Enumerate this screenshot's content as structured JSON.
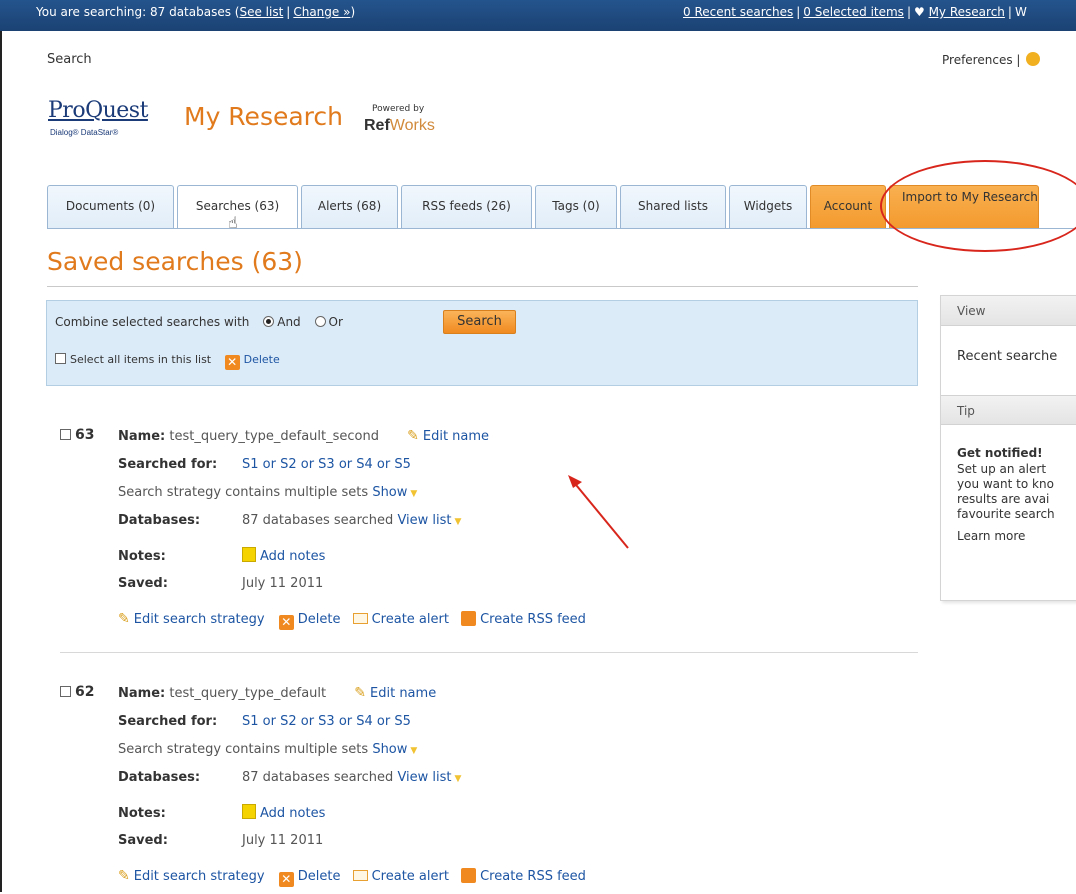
{
  "topbar": {
    "searching_prefix": "You are searching: 87 databases (",
    "see_list": "See list",
    "change": "Change »",
    "searching_suffix": ")",
    "recent_searches": "0 Recent searches",
    "selected_items": "0 Selected items",
    "my_research": "My Research",
    "trailing": "W"
  },
  "header": {
    "search_link": "Search",
    "preferences": "Preferences",
    "logo_text": "ProQuest",
    "logo_sub": "Dialog® DataStar®",
    "app_title": "My Research",
    "powered_by": "Powered by",
    "refworks_ref": "Ref",
    "refworks_works": "Works"
  },
  "tabs": [
    {
      "label": "Documents (0)"
    },
    {
      "label": "Searches (63)"
    },
    {
      "label": "Alerts (68)"
    },
    {
      "label": "RSS feeds (26)"
    },
    {
      "label": "Tags (0)"
    },
    {
      "label": "Shared lists"
    },
    {
      "label": "Widgets"
    },
    {
      "label": "Account"
    },
    {
      "label": "Import to My Research"
    }
  ],
  "page_title": "Saved searches (63)",
  "combine": {
    "label": "Combine selected searches with",
    "and": "And",
    "or": "Or",
    "selected": "And",
    "search_button": "Search",
    "select_all": "Select all items in this list",
    "delete": "Delete"
  },
  "records": [
    {
      "number": "63",
      "name_label": "Name:",
      "name": "test_query_type_default_second",
      "edit_name": "Edit name",
      "searched_for_label": "Searched for:",
      "searched_for": "S1 or S2 or S3 or S4 or S5",
      "strategy_text": "Search strategy contains multiple sets",
      "show": "Show",
      "databases_label": "Databases:",
      "databases": "87 databases searched",
      "view_list": "View list",
      "notes_label": "Notes:",
      "add_notes": "Add notes",
      "saved_label": "Saved:",
      "saved": "July 11 2011",
      "edit_strategy": "Edit search strategy",
      "delete": "Delete",
      "create_alert": "Create alert",
      "create_rss": "Create RSS feed"
    },
    {
      "number": "62",
      "name_label": "Name:",
      "name": "test_query_type_default",
      "edit_name": "Edit name",
      "searched_for_label": "Searched for:",
      "searched_for": "S1 or S2 or S3 or S4 or S5",
      "strategy_text": "Search strategy contains multiple sets",
      "show": "Show",
      "databases_label": "Databases:",
      "databases": "87 databases searched",
      "view_list": "View list",
      "notes_label": "Notes:",
      "add_notes": "Add notes",
      "saved_label": "Saved:",
      "saved": "July 11 2011",
      "edit_strategy": "Edit search strategy",
      "delete": "Delete",
      "create_alert": "Create alert",
      "create_rss": "Create RSS feed"
    }
  ],
  "sidebar": {
    "view_heading": "View",
    "recent_searches": "Recent searche",
    "tip_heading": "Tip",
    "tip_title": "Get notified!",
    "tip_lines": [
      "Set up an alert",
      "you want to kno",
      "results are avai",
      "favourite search"
    ],
    "learn_more": "Learn more"
  },
  "colors": {
    "accent_orange": "#e07a1c",
    "topbar_blue": "#1b4273",
    "annotation_red": "#d8261c"
  }
}
